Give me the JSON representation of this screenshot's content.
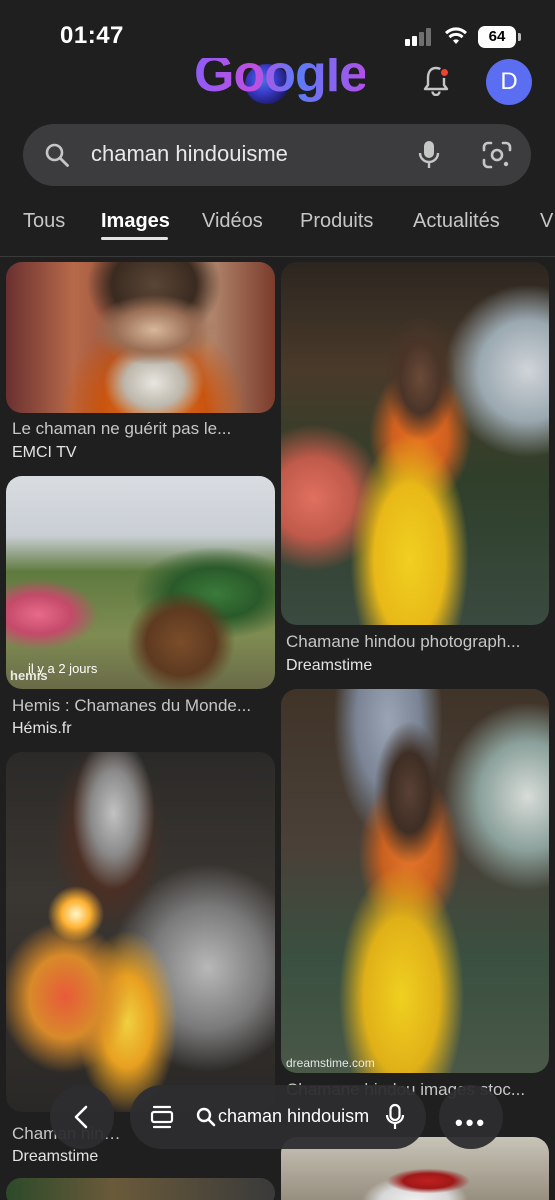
{
  "status_bar": {
    "time": "01:47",
    "battery": "64"
  },
  "header": {
    "logo_text": "Google",
    "avatar_letter": "D"
  },
  "search": {
    "query": "chaman hindouisme"
  },
  "tabs": [
    {
      "label": "Tous"
    },
    {
      "label": "Images"
    },
    {
      "label": "Vidéos"
    },
    {
      "label": "Produits"
    },
    {
      "label": "Actualités"
    },
    {
      "label": "V"
    }
  ],
  "results": [
    {
      "caption": "Le chaman ne guérit pas le...",
      "source": "EMCI TV"
    },
    {
      "caption": "Hemis : Chamanes du Monde...",
      "source": "Hémis.fr",
      "badge": "il y a 2 jours",
      "watermark": "hemis"
    },
    {
      "caption": "Chaman hindou...",
      "source": "Dreamstime"
    },
    {
      "caption": "Chamane hindou photograph...",
      "source": "Dreamstime"
    },
    {
      "caption": "Chamane hindou images stoc...",
      "source": "Dreamstime",
      "watermark": "dreamstime.com"
    }
  ],
  "bottom_bar": {
    "query": "chaman hindouisme"
  },
  "colors": {
    "background": "#1f1f1f",
    "search_box": "#3c3c3f",
    "avatar": "#5b6df0",
    "accent_doodle": "#8e5cf7"
  }
}
